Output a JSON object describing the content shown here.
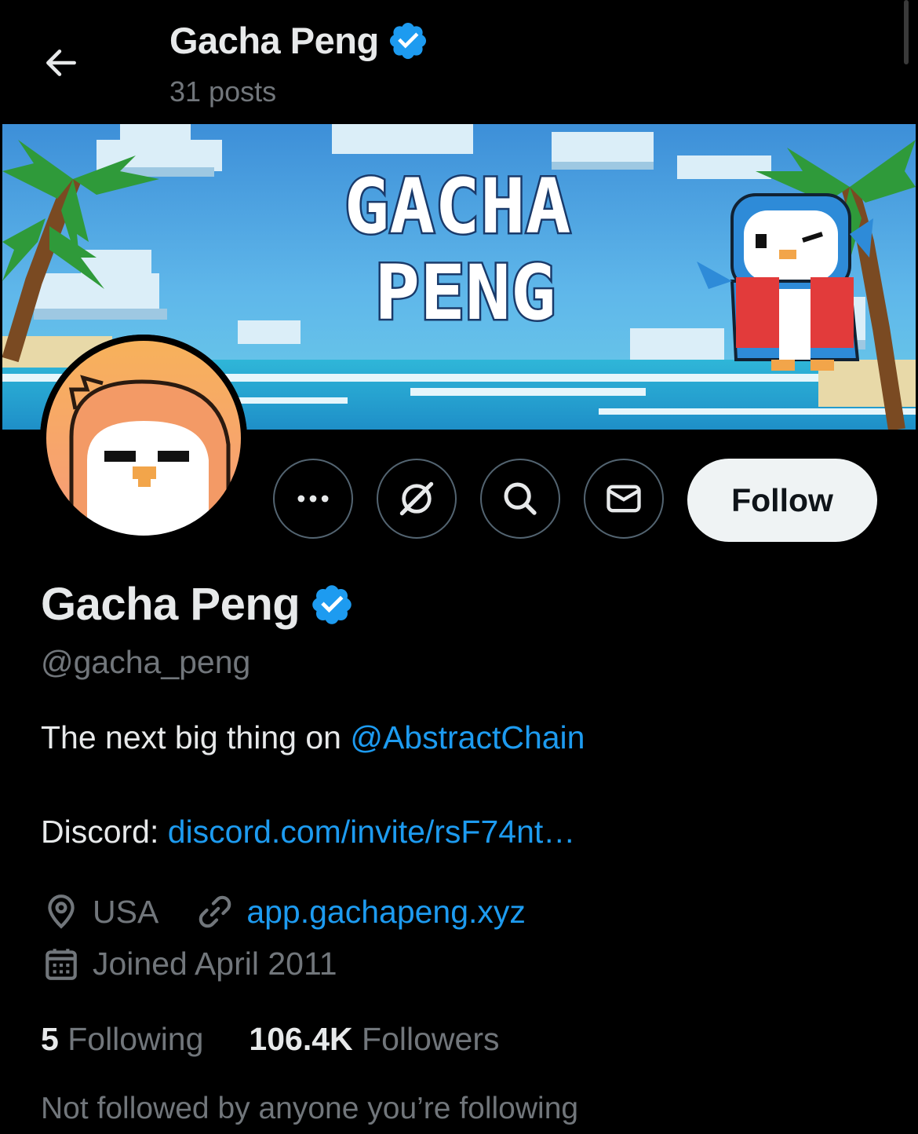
{
  "header": {
    "title": "Gacha Peng",
    "posts_count": "31 posts"
  },
  "banner": {
    "line1": "GACHA",
    "line2": "PENG"
  },
  "profile": {
    "name": "Gacha Peng",
    "handle": "@gacha_peng",
    "bio_text": "The next big thing on ",
    "bio_mention": "@AbstractChain",
    "discord_label": "Discord: ",
    "discord_link": "discord.com/invite/rsF74nt…",
    "location": "USA",
    "website": "app.gachapeng.xyz",
    "joined": "Joined April 2011",
    "following_count": "5",
    "following_label": "Following",
    "followers_count": "106.4K",
    "followers_label": "Followers",
    "not_followed_text": "Not followed by anyone you’re following"
  },
  "actions": {
    "follow_label": "Follow",
    "icons": [
      "more-icon",
      "grok-icon",
      "search-icon",
      "message-icon"
    ]
  },
  "colors": {
    "background": "#000000",
    "text": "#e7e9ea",
    "muted": "#71767b",
    "link": "#1d9bf0",
    "verified": "#1d9bf0",
    "follow_bg": "#eff3f4"
  }
}
